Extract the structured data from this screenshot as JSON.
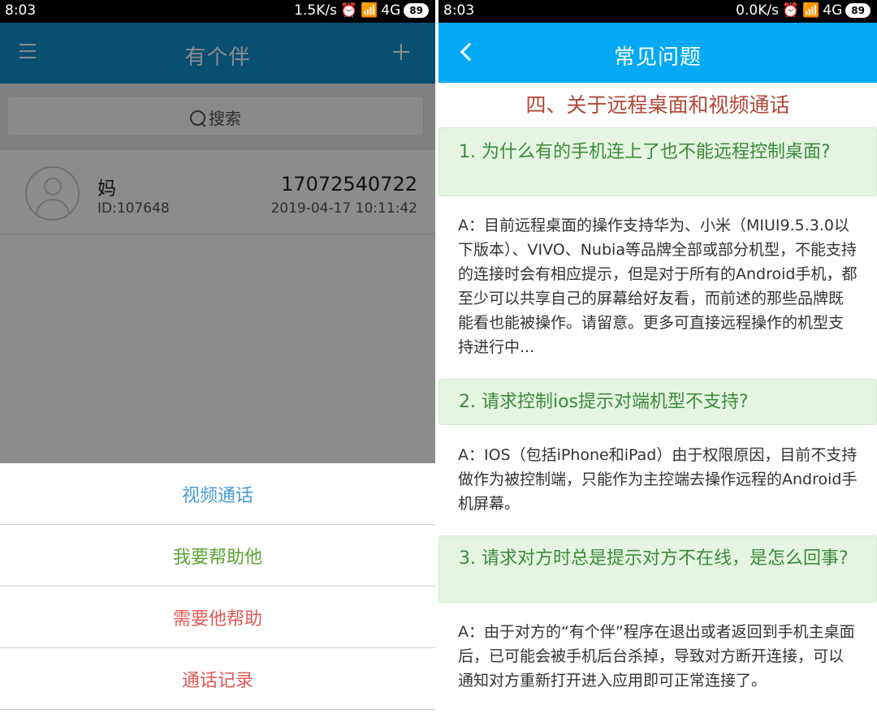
{
  "left": {
    "status": {
      "time": "8:03",
      "net": "1.5K/s",
      "signal": "4G",
      "battery": "89"
    },
    "toolbar": {
      "title": "有个伴"
    },
    "search": {
      "label": "搜索"
    },
    "contact": {
      "name": "妈",
      "id": "ID:107648",
      "phone": "17072540722",
      "datetime": "2019-04-17 10:11:42"
    },
    "sheet": {
      "items": [
        {
          "label": "视频通话",
          "color": "#4a9bd6"
        },
        {
          "label": "我要帮助他",
          "color": "#5aa532"
        },
        {
          "label": "需要他帮助",
          "color": "#e05a5a"
        },
        {
          "label": "通话记录",
          "color": "#e05a5a"
        }
      ]
    }
  },
  "right": {
    "status": {
      "time": "8:03",
      "net": "0.0K/s",
      "signal": "4G",
      "battery": "89"
    },
    "toolbar": {
      "title": "常见问题"
    },
    "section_title": "四、关于远程桌面和视频通话",
    "faq": [
      {
        "q": "1. 为什么有的手机连上了也不能远程控制桌面?",
        "a": "A：目前远程桌面的操作支持华为、小米（MIUI9.5.3.0以下版本）、VIVO、Nubia等品牌全部或部分机型，不能支持的连接时会有相应提示，但是对于所有的Android手机，都至少可以共享自己的屏幕给好友看，而前述的那些品牌既能看也能被操作。请留意。更多可直接远程操作的机型支持进行中..."
      },
      {
        "q": "2. 请求控制ios提示对端机型不支持?",
        "a": "A：IOS（包括iPhone和iPad）由于权限原因，目前不支持做作为被控制端，只能作为主控端去操作远程的Android手机屏幕。"
      },
      {
        "q": "3. 请求对方时总是提示对方不在线，是怎么回事?",
        "a": "A：由于对方的“有个伴”程序在退出或者返回到手机主桌面后，已可能会被手机后台杀掉，导致对方断开连接，可以通知对方重新打开进入应用即可正常连接了。"
      }
    ]
  }
}
